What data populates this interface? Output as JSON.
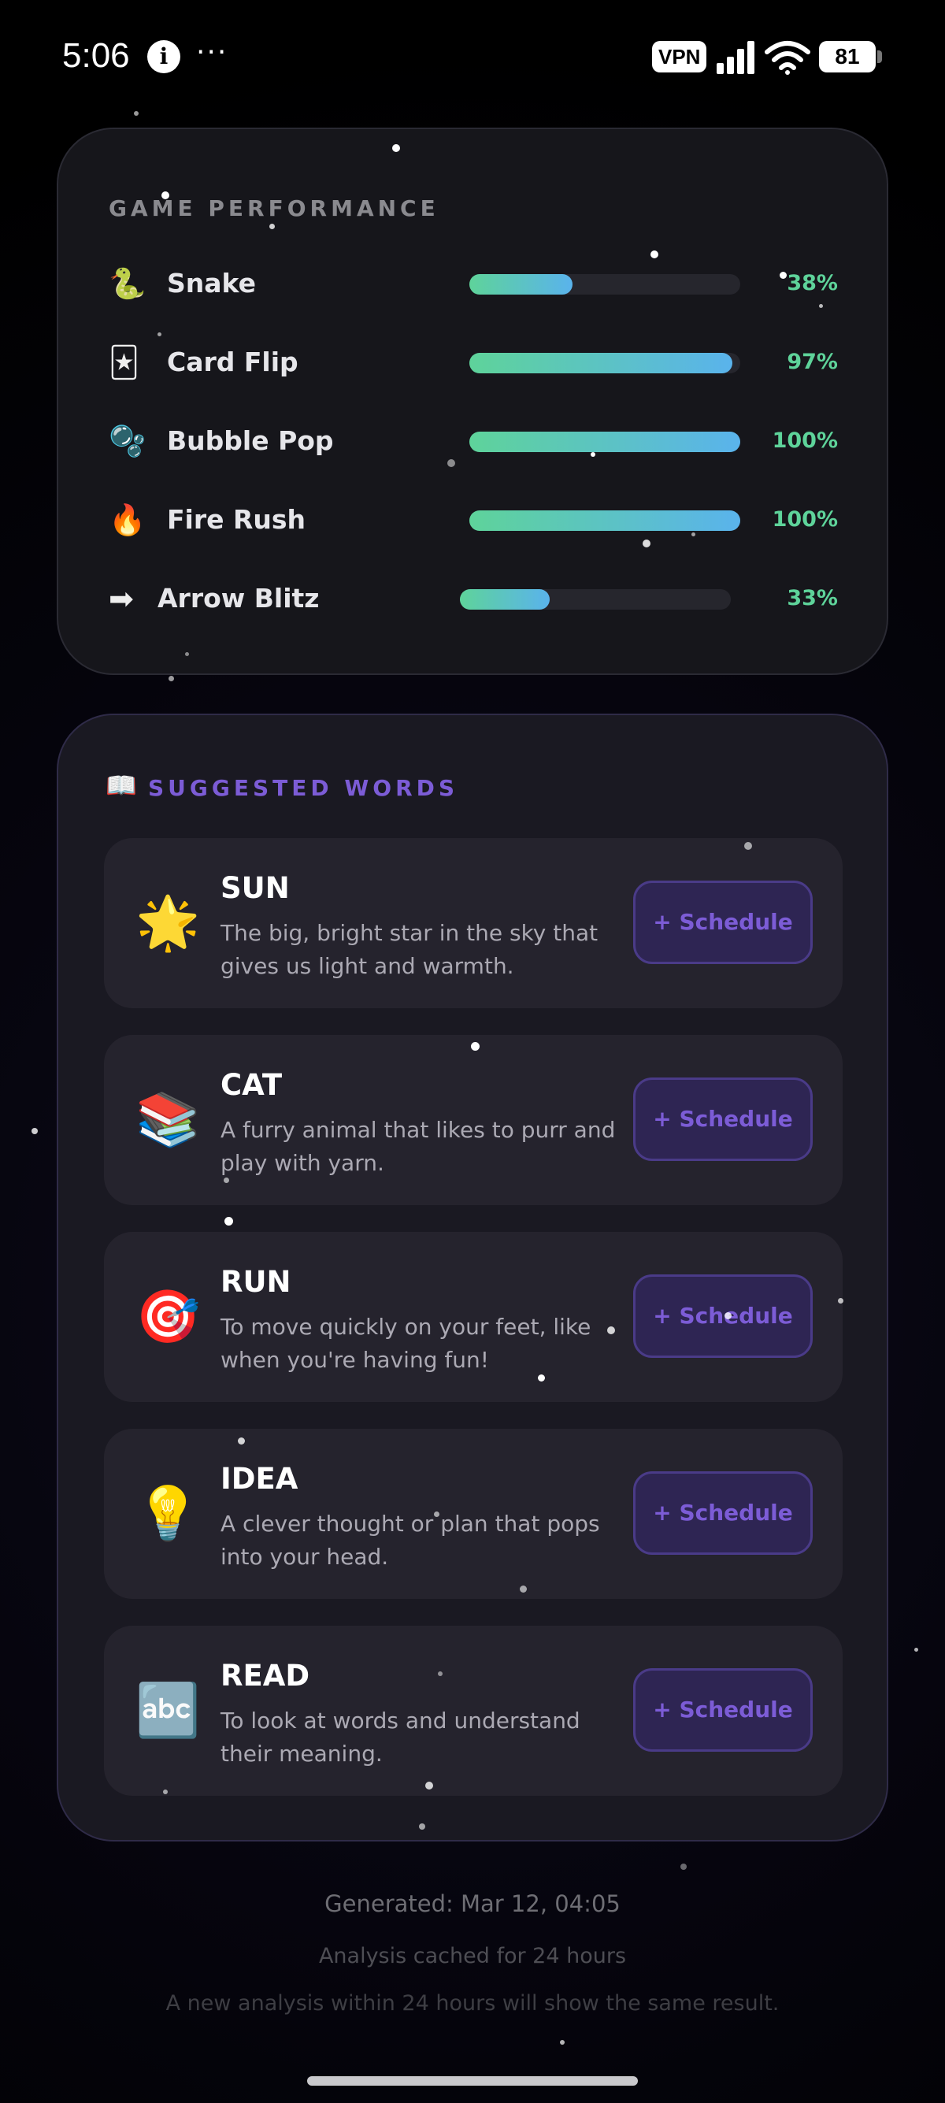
{
  "status_bar": {
    "time": "5:06",
    "info_glyph": "i",
    "more_glyph": "···",
    "vpn_label": "VPN",
    "battery": "81"
  },
  "performance": {
    "title": "GAME PERFORMANCE",
    "games": [
      {
        "icon": "🐍",
        "icon_name": "snake-icon",
        "name": "Snake",
        "percent": "38%",
        "fill": 0.38
      },
      {
        "icon": "🃏",
        "icon_name": "card-icon",
        "name": "Card Flip",
        "percent": "97%",
        "fill": 0.97
      },
      {
        "icon": "🫧",
        "icon_name": "bubbles-icon",
        "name": "Bubble Pop",
        "percent": "100%",
        "fill": 1.0
      },
      {
        "icon": "🔥",
        "icon_name": "fire-icon",
        "name": "Fire Rush",
        "percent": "100%",
        "fill": 1.0
      },
      {
        "icon": "➡",
        "icon_name": "arrow-right-icon",
        "name": "Arrow Blitz",
        "percent": "33%",
        "fill": 0.33
      }
    ]
  },
  "suggested": {
    "icon": "📖",
    "title": "SUGGESTED WORDS",
    "schedule_label": "+ Schedule",
    "words": [
      {
        "emoji": "🌟",
        "emoji_name": "star-icon",
        "word": "SUN",
        "definition": "The big, bright star in the sky that gives us light and warmth."
      },
      {
        "emoji": "📚",
        "emoji_name": "books-icon",
        "word": "CAT",
        "definition": "A furry animal that likes to purr and play with yarn."
      },
      {
        "emoji": "🎯",
        "emoji_name": "target-icon",
        "word": "RUN",
        "definition": "To move quickly on your feet, like when you're having fun!"
      },
      {
        "emoji": "💡",
        "emoji_name": "lightbulb-icon",
        "word": "IDEA",
        "definition": "A clever thought or plan that pops into your head."
      },
      {
        "emoji": "🔤",
        "emoji_name": "abc-icon",
        "word": "READ",
        "definition": "To look at words and understand their meaning."
      }
    ]
  },
  "footer": {
    "generated": "Generated: Mar 12, 04:05",
    "cached": "Analysis cached for 24 hours",
    "note": "A new analysis within 24 hours will show the same result."
  },
  "colors": {
    "accent_purple": "#7c5cd6",
    "bar_green": "#5ed39a",
    "bar_blue": "#5ab3ec"
  }
}
